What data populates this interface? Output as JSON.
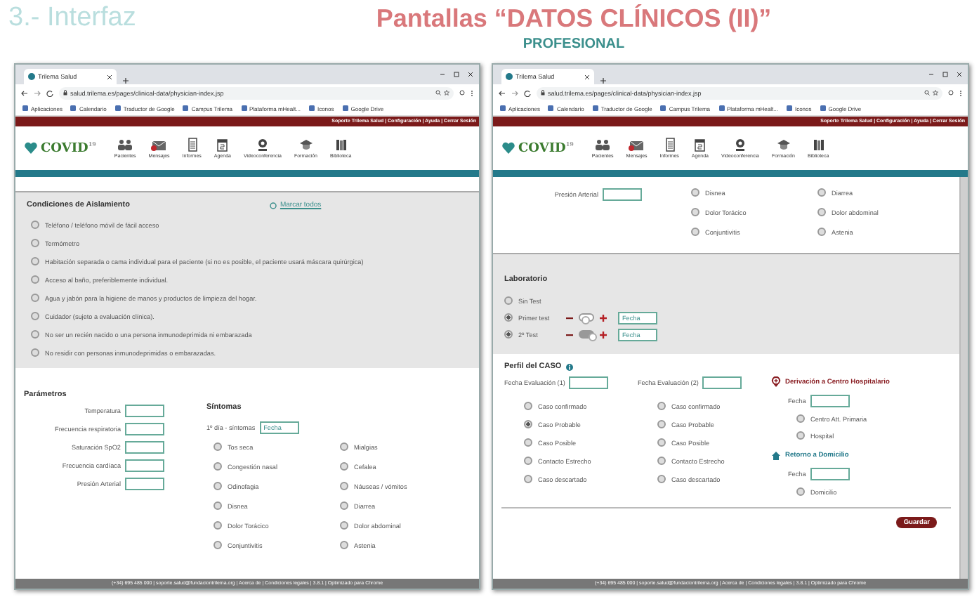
{
  "slide": {
    "section": "3.- Interfaz",
    "title": "Pantallas “DATOS CLÍNICOS (II)”",
    "subtitle": "PROFESIONAL"
  },
  "windows": [
    {
      "tab": "Trilema Salud",
      "url": "salud.trilema.es/pages/clinical-data/physician-index.jsp",
      "bookmarks": [
        "Aplicaciones",
        "Calendario",
        "Traductor de Google",
        "Campus Trilema",
        "Plataforma mHealt...",
        "Iconos",
        "Google Drive"
      ],
      "top_links": "Soporte Trilema Salud | Configuración | Ayuda | Cerrar Sesión",
      "logo": {
        "text": "COVID",
        "sup": "19"
      },
      "nav": [
        "Pacientes",
        "Mensajes",
        "Informes",
        "Agenda",
        "Videoconferencia",
        "Formación",
        "Biblioteca"
      ],
      "sections": [
        {
          "kind": "checklist",
          "title": "Condiciones de Aislamiento",
          "action": "Marcar todos",
          "items": [
            {
              "label": "Teléfono / teléfono móvil de fácil acceso",
              "checked": false
            },
            {
              "label": "Termómetro",
              "checked": false
            },
            {
              "label": "Habitación separada o cama individual para el paciente (si no es posible, el paciente usará máscara quirúrgica)",
              "checked": false
            },
            {
              "label": "Acceso al baño, preferiblemente individual.",
              "checked": false
            },
            {
              "label": "Agua y jabón para la higiene de manos y productos de limpieza del hogar.",
              "checked": false
            },
            {
              "label": "Cuidador (sujeto a evaluación clínica).",
              "checked": false
            },
            {
              "label": "No ser un recién nacido o una persona inmunodeprimida ni embarazada",
              "checked": false
            },
            {
              "label": "No residir con personas inmunodeprimidas o embarazadas.",
              "checked": false
            }
          ]
        },
        {
          "kind": "params_symptoms",
          "params_title": "Parámetros",
          "fields": [
            "Temperatura",
            "Frecuencia respiratoria",
            "Saturación SpO2",
            "Frecuencia cardíaca",
            "Presión Arterial"
          ],
          "symptoms_title": "Síntomas",
          "date_label": "1º día - síntomas",
          "date_placeholder": "Fecha",
          "items": [
            {
              "label": "Tos seca",
              "checked": false
            },
            {
              "label": "Mialgias",
              "checked": false
            },
            {
              "label": "Congestión nasal",
              "checked": false
            },
            {
              "label": "Cefalea",
              "checked": false
            },
            {
              "label": "Odinofagia",
              "checked": false
            },
            {
              "label": "Náuseas / vómitos",
              "checked": false
            },
            {
              "label": "Disnea",
              "checked": false
            },
            {
              "label": "Diarrea",
              "checked": false
            },
            {
              "label": "Dolor Torácico",
              "checked": false
            },
            {
              "label": "Dolor abdominal",
              "checked": false
            },
            {
              "label": "Conjuntivitis",
              "checked": false
            },
            {
              "label": "Astenia",
              "checked": false
            }
          ]
        }
      ],
      "footer": "(+34) 695 485 000 | soporte.salud@fundaciontrilema.org | Acerca de | Condiciones legales | 3.8.1 | Optimizado para Chrome"
    },
    {
      "tab": "Trilema Salud",
      "url": "salud.trilema.es/pages/clinical-data/physician-index.jsp",
      "bookmarks": [
        "Aplicaciones",
        "Calendario",
        "Traductor de Google",
        "Campus Trilema",
        "Plataforma mHealt...",
        "Iconos",
        "Google Drive"
      ],
      "top_links": "Soporte Trilema Salud | Configuración | Ayuda | Cerrar Sesión",
      "logo": {
        "text": "COVID",
        "sup": "19"
      },
      "nav": [
        "Pacientes",
        "Mensajes",
        "Informes",
        "Agenda",
        "Videoconferencia",
        "Formación",
        "Biblioteca"
      ],
      "sections": [
        {
          "kind": "params_symptoms",
          "fields": [
            "Presión Arterial"
          ],
          "items": [
            {
              "label": "Disnea",
              "checked": false
            },
            {
              "label": "Diarrea",
              "checked": false
            },
            {
              "label": "Dolor Torácico",
              "checked": false
            },
            {
              "label": "Dolor abdominal",
              "checked": false
            },
            {
              "label": "Conjuntivitis",
              "checked": false
            },
            {
              "label": "Astenia",
              "checked": false
            }
          ]
        },
        {
          "kind": "laboratory",
          "title": "Laboratorio",
          "items": [
            {
              "label": "Sin Test",
              "checked": false
            },
            {
              "label": "Primer test",
              "checked": true,
              "toggle_on": false,
              "date_placeholder": "Fecha"
            },
            {
              "label": "2º Test",
              "checked": true,
              "toggle_on": true,
              "date_placeholder": "Fecha"
            }
          ]
        },
        {
          "kind": "case_profile",
          "title": "Perfil del CASO",
          "columns": [
            {
              "date_label": "Fecha Evaluación (1)",
              "items": [
                {
                  "label": "Caso confirmado",
                  "selected": false
                },
                {
                  "label": "Caso Probable",
                  "selected": true
                },
                {
                  "label": "Caso Posible",
                  "selected": false
                },
                {
                  "label": "Contacto Estrecho",
                  "selected": false
                },
                {
                  "label": "Caso descartado",
                  "selected": false
                }
              ]
            },
            {
              "date_label": "Fecha Evaluación (2)",
              "items": [
                {
                  "label": "Caso confirmado",
                  "selected": false
                },
                {
                  "label": "Caso Probable",
                  "selected": false
                },
                {
                  "label": "Caso Posible",
                  "selected": false
                },
                {
                  "label": "Contacto Estrecho",
                  "selected": false
                },
                {
                  "label": "Caso descartado",
                  "selected": false
                }
              ]
            }
          ],
          "referral": {
            "title": "Derivación a Centro Hospitalario",
            "date_label": "Fecha",
            "items": [
              {
                "label": "Centro Att. Primaria",
                "selected": false
              },
              {
                "label": "Hospital",
                "selected": false
              }
            ]
          },
          "home": {
            "title": "Retorno a Domicilio",
            "date_label": "Fecha",
            "items": [
              {
                "label": "Domicilio",
                "selected": false
              }
            ]
          }
        },
        {
          "kind": "actions",
          "button": "Guardar"
        }
      ],
      "footer": "(+34) 695 485 000 | soporte.salud@fundaciontrilema.org | Acerca de | Condiciones legales | 3.8.1 | Optimizado para Chrome"
    }
  ]
}
